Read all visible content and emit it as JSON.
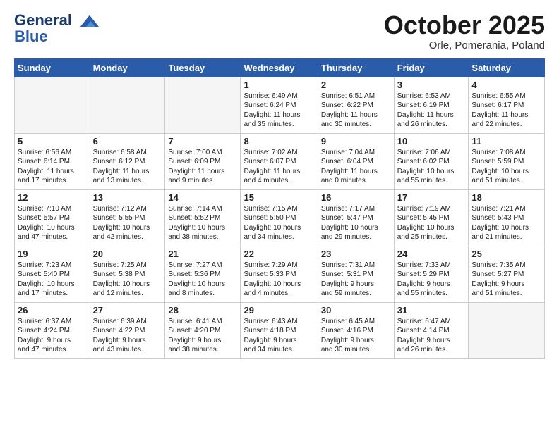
{
  "header": {
    "logo_line1": "General",
    "logo_line2": "Blue",
    "month": "October 2025",
    "location": "Orle, Pomerania, Poland"
  },
  "weekdays": [
    "Sunday",
    "Monday",
    "Tuesday",
    "Wednesday",
    "Thursday",
    "Friday",
    "Saturday"
  ],
  "weeks": [
    [
      {
        "day": "",
        "info": ""
      },
      {
        "day": "",
        "info": ""
      },
      {
        "day": "",
        "info": ""
      },
      {
        "day": "1",
        "info": "Sunrise: 6:49 AM\nSunset: 6:24 PM\nDaylight: 11 hours\nand 35 minutes."
      },
      {
        "day": "2",
        "info": "Sunrise: 6:51 AM\nSunset: 6:22 PM\nDaylight: 11 hours\nand 30 minutes."
      },
      {
        "day": "3",
        "info": "Sunrise: 6:53 AM\nSunset: 6:19 PM\nDaylight: 11 hours\nand 26 minutes."
      },
      {
        "day": "4",
        "info": "Sunrise: 6:55 AM\nSunset: 6:17 PM\nDaylight: 11 hours\nand 22 minutes."
      }
    ],
    [
      {
        "day": "5",
        "info": "Sunrise: 6:56 AM\nSunset: 6:14 PM\nDaylight: 11 hours\nand 17 minutes."
      },
      {
        "day": "6",
        "info": "Sunrise: 6:58 AM\nSunset: 6:12 PM\nDaylight: 11 hours\nand 13 minutes."
      },
      {
        "day": "7",
        "info": "Sunrise: 7:00 AM\nSunset: 6:09 PM\nDaylight: 11 hours\nand 9 minutes."
      },
      {
        "day": "8",
        "info": "Sunrise: 7:02 AM\nSunset: 6:07 PM\nDaylight: 11 hours\nand 4 minutes."
      },
      {
        "day": "9",
        "info": "Sunrise: 7:04 AM\nSunset: 6:04 PM\nDaylight: 11 hours\nand 0 minutes."
      },
      {
        "day": "10",
        "info": "Sunrise: 7:06 AM\nSunset: 6:02 PM\nDaylight: 10 hours\nand 55 minutes."
      },
      {
        "day": "11",
        "info": "Sunrise: 7:08 AM\nSunset: 5:59 PM\nDaylight: 10 hours\nand 51 minutes."
      }
    ],
    [
      {
        "day": "12",
        "info": "Sunrise: 7:10 AM\nSunset: 5:57 PM\nDaylight: 10 hours\nand 47 minutes."
      },
      {
        "day": "13",
        "info": "Sunrise: 7:12 AM\nSunset: 5:55 PM\nDaylight: 10 hours\nand 42 minutes."
      },
      {
        "day": "14",
        "info": "Sunrise: 7:14 AM\nSunset: 5:52 PM\nDaylight: 10 hours\nand 38 minutes."
      },
      {
        "day": "15",
        "info": "Sunrise: 7:15 AM\nSunset: 5:50 PM\nDaylight: 10 hours\nand 34 minutes."
      },
      {
        "day": "16",
        "info": "Sunrise: 7:17 AM\nSunset: 5:47 PM\nDaylight: 10 hours\nand 29 minutes."
      },
      {
        "day": "17",
        "info": "Sunrise: 7:19 AM\nSunset: 5:45 PM\nDaylight: 10 hours\nand 25 minutes."
      },
      {
        "day": "18",
        "info": "Sunrise: 7:21 AM\nSunset: 5:43 PM\nDaylight: 10 hours\nand 21 minutes."
      }
    ],
    [
      {
        "day": "19",
        "info": "Sunrise: 7:23 AM\nSunset: 5:40 PM\nDaylight: 10 hours\nand 17 minutes."
      },
      {
        "day": "20",
        "info": "Sunrise: 7:25 AM\nSunset: 5:38 PM\nDaylight: 10 hours\nand 12 minutes."
      },
      {
        "day": "21",
        "info": "Sunrise: 7:27 AM\nSunset: 5:36 PM\nDaylight: 10 hours\nand 8 minutes."
      },
      {
        "day": "22",
        "info": "Sunrise: 7:29 AM\nSunset: 5:33 PM\nDaylight: 10 hours\nand 4 minutes."
      },
      {
        "day": "23",
        "info": "Sunrise: 7:31 AM\nSunset: 5:31 PM\nDaylight: 9 hours\nand 59 minutes."
      },
      {
        "day": "24",
        "info": "Sunrise: 7:33 AM\nSunset: 5:29 PM\nDaylight: 9 hours\nand 55 minutes."
      },
      {
        "day": "25",
        "info": "Sunrise: 7:35 AM\nSunset: 5:27 PM\nDaylight: 9 hours\nand 51 minutes."
      }
    ],
    [
      {
        "day": "26",
        "info": "Sunrise: 6:37 AM\nSunset: 4:24 PM\nDaylight: 9 hours\nand 47 minutes."
      },
      {
        "day": "27",
        "info": "Sunrise: 6:39 AM\nSunset: 4:22 PM\nDaylight: 9 hours\nand 43 minutes."
      },
      {
        "day": "28",
        "info": "Sunrise: 6:41 AM\nSunset: 4:20 PM\nDaylight: 9 hours\nand 38 minutes."
      },
      {
        "day": "29",
        "info": "Sunrise: 6:43 AM\nSunset: 4:18 PM\nDaylight: 9 hours\nand 34 minutes."
      },
      {
        "day": "30",
        "info": "Sunrise: 6:45 AM\nSunset: 4:16 PM\nDaylight: 9 hours\nand 30 minutes."
      },
      {
        "day": "31",
        "info": "Sunrise: 6:47 AM\nSunset: 4:14 PM\nDaylight: 9 hours\nand 26 minutes."
      },
      {
        "day": "",
        "info": ""
      }
    ]
  ]
}
